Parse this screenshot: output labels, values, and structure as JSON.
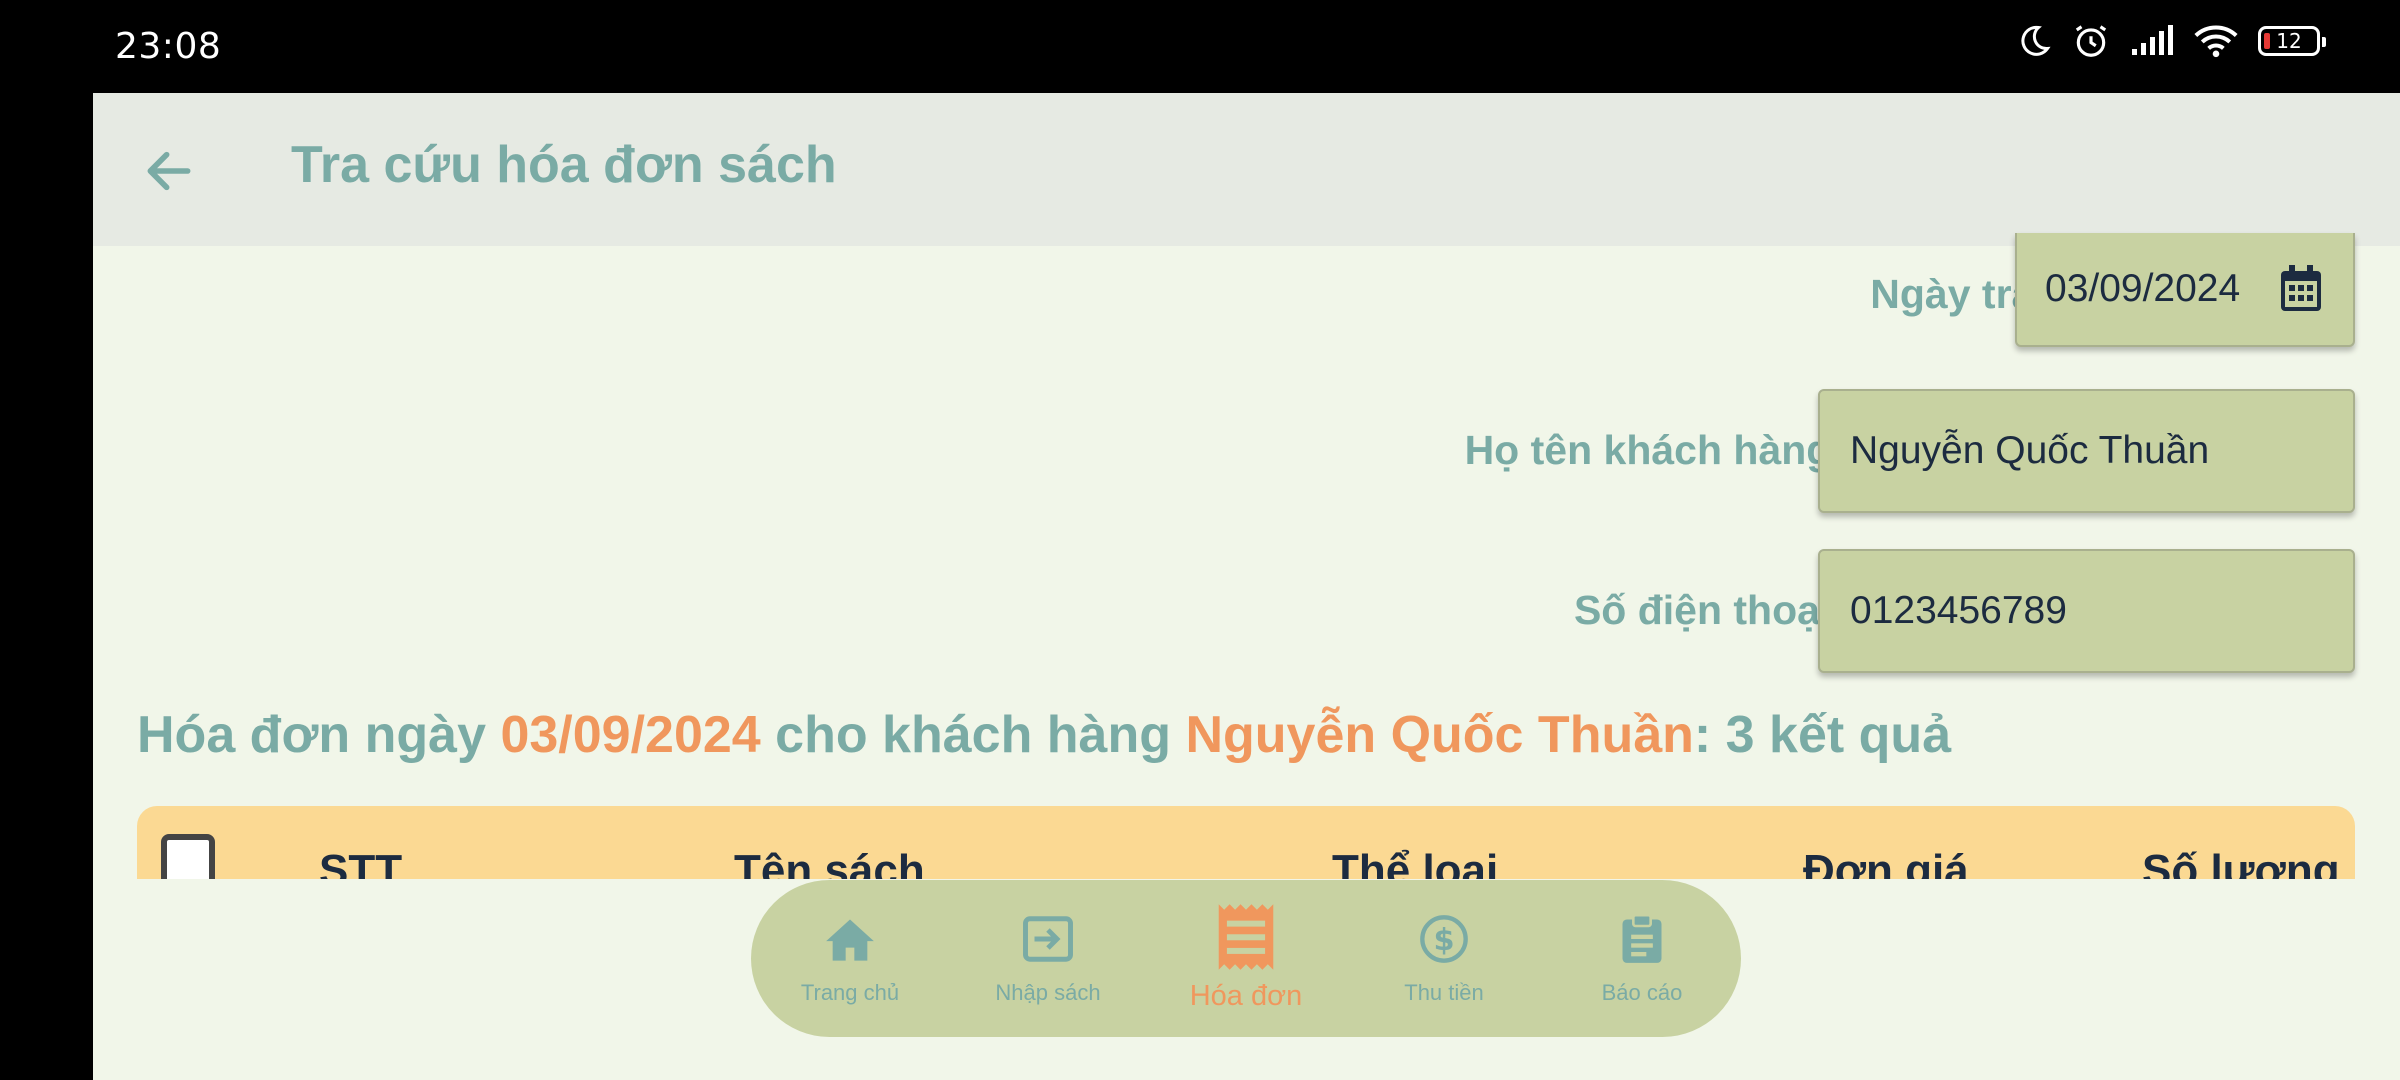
{
  "status": {
    "time": "23:08",
    "battery": "12"
  },
  "header": {
    "title": "Tra cứu hóa đơn sách"
  },
  "form": {
    "date_label": "Ngày tra:",
    "date_value": "03/09/2024",
    "name_label": "Họ tên khách hàng:",
    "name_value": "Nguyễn Quốc Thuần",
    "phone_label": "Số điện thoại:",
    "phone_value": "0123456789"
  },
  "result": {
    "prefix": "Hóa đơn ngày ",
    "date": "03/09/2024",
    "middle": " cho khách hàng ",
    "customer": "Nguyễn Quốc Thuần",
    "suffix": ": 3 kết quả"
  },
  "table": {
    "columns": [
      "STT",
      "Tên sách",
      "Thể loại",
      "Đơn giá",
      "Số lượng"
    ]
  },
  "bottom_nav": {
    "items": [
      {
        "label": "Trang chủ",
        "icon": "home-icon"
      },
      {
        "label": "Nhập sách",
        "icon": "import-icon"
      },
      {
        "label": "Hóa đơn",
        "icon": "receipt-icon",
        "active": true
      },
      {
        "label": "Thu tiền",
        "icon": "dollar-icon"
      },
      {
        "label": "Báo cáo",
        "icon": "clipboard-icon"
      }
    ]
  },
  "colors": {
    "primary_text": "#7aaba5",
    "accent": "#f0975d",
    "field_bg": "#c8d2a2",
    "table_header_bg": "#fbd993",
    "background": "#f1f6e9"
  }
}
